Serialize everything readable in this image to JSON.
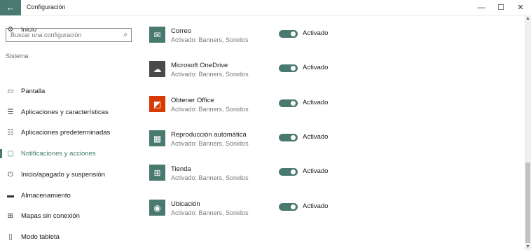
{
  "window": {
    "title": "Configuración",
    "back_icon": "←",
    "minimize_icon": "—",
    "maximize_icon": "☐",
    "close_icon": "✕",
    "accent_color": "#4a7a6f"
  },
  "sidebar": {
    "home": {
      "icon": "⚙",
      "label": "Inicio"
    },
    "search_placeholder": "Buscar una configuración",
    "search_icon": "⌕",
    "section": "Sistema",
    "items": [
      {
        "icon": "▭",
        "label": "Pantalla"
      },
      {
        "icon": "☰",
        "label": "Aplicaciones y características"
      },
      {
        "icon": "☷",
        "label": "Aplicaciones predeterminadas"
      },
      {
        "icon": "▢",
        "label": "Notificaciones y acciones",
        "active": true
      },
      {
        "icon": "⏻",
        "label": "Inicio/apagado y suspensión"
      },
      {
        "icon": "▬",
        "label": "Almacenamiento"
      },
      {
        "icon": "⊞",
        "label": "Mapas sin conexión"
      },
      {
        "icon": "▯",
        "label": "Modo tableta"
      }
    ]
  },
  "apps": [
    {
      "icon": "✉",
      "name": "Correo",
      "sub": "Activado: Banners, Sonidos",
      "toggle": "Activado",
      "icon_bg": "#4a7a6f"
    },
    {
      "icon": "☁",
      "name": "Microsoft OneDrive",
      "sub": "Activado: Banners, Sonidos",
      "toggle": "Activado",
      "icon_bg": "#4a4a4a"
    },
    {
      "icon": "◩",
      "name": "Obtener Office",
      "sub": "Activado: Banners, Sonidos",
      "toggle": "Activado",
      "icon_bg": "#d83b01"
    },
    {
      "icon": "▦",
      "name": "Reproducción automática",
      "sub": "Activado: Banners, Sonidos",
      "toggle": "Activado",
      "icon_bg": "#4a7a6f"
    },
    {
      "icon": "⊞",
      "name": "Tienda",
      "sub": "Activado: Banners, Sonidos",
      "toggle": "Activado",
      "icon_bg": "#4a7a6f"
    },
    {
      "icon": "◉",
      "name": "Ubicación",
      "sub": "Activado: Banners, Sonidos",
      "toggle": "Activado",
      "icon_bg": "#4a7a6f"
    }
  ]
}
